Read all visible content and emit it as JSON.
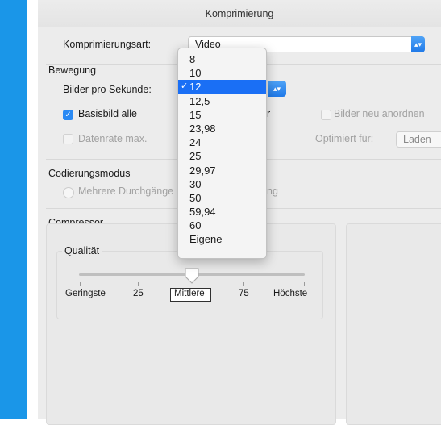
{
  "window": {
    "title": "Komprimierung"
  },
  "compression": {
    "label": "Komprimierungsart:",
    "value": "Video",
    "arrow": "⌃⌄"
  },
  "motion": {
    "heading": "Bewegung",
    "fps_label": "Bilder pro Sekunde:",
    "keyframe_label": "Basisbild alle",
    "keyframe_suffix": "r",
    "reorder_label": "Bilder neu anordnen",
    "datarate_label": "Datenrate max.",
    "optimized_label": "Optimiert für:",
    "optimized_value": "Laden"
  },
  "encoding": {
    "heading": "Codierungsmodus",
    "multipass_label": "Mehrere Durchgänge",
    "multipass_suffix": "ng"
  },
  "compressor": {
    "heading": "Compressor",
    "quality_label": "Qualität",
    "quality_level": 0.5,
    "ticks": {
      "lowest": "Geringste",
      "q25": "25",
      "medium": "Mittlere",
      "q75": "75",
      "highest": "Höchste"
    }
  },
  "fps_menu": {
    "selected": "12",
    "items": [
      "8",
      "10",
      "12",
      "12,5",
      "15",
      "23,98",
      "24",
      "25",
      "29,97",
      "30",
      "50",
      "59,94",
      "60",
      "Eigene"
    ]
  },
  "colors": {
    "accent": "#1a6ff5",
    "side_strip": "#1a96e8"
  }
}
